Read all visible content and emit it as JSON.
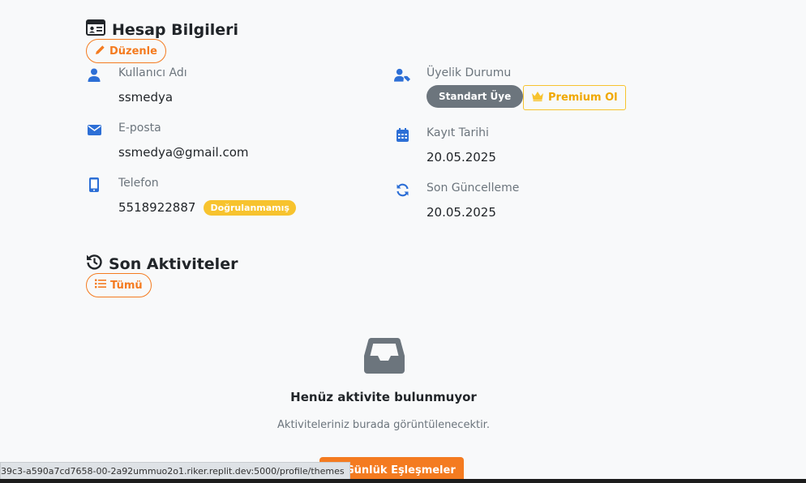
{
  "account": {
    "title": "Hesap Bilgileri",
    "edit_label": "Düzenle",
    "fields": {
      "username": {
        "label": "Kullanıcı Adı",
        "value": "ssmedya"
      },
      "email": {
        "label": "E-posta",
        "value": "ssmedya@gmail.com"
      },
      "phone": {
        "label": "Telefon",
        "value": "5518922887",
        "badge": "Doğrulanmamış"
      },
      "membership": {
        "label": "Üyelik Durumu",
        "badge": "Standart Üye",
        "premium_label": "Premium Ol"
      },
      "registered": {
        "label": "Kayıt Tarihi",
        "value": "20.05.2025"
      },
      "updated": {
        "label": "Son Güncelleme",
        "value": "20.05.2025"
      }
    }
  },
  "activities": {
    "title": "Son Aktiviteler",
    "all_label": "Tümü",
    "empty_title": "Henüz aktivite bulunmuyor",
    "empty_subtitle": "Aktiviteleriniz burada görüntülenecektir.",
    "daily_matches_label": "Günlük Eşleşmeler"
  },
  "status_bar": {
    "url": "39c3-a590a7cd7658-00-2a92ummuo2o1.riker.replit.dev:5000/profile/themes"
  },
  "colors": {
    "accent": "#f47b20",
    "icon_blue": "#2d6fd6",
    "warning": "#f7c32e",
    "secondary": "#6c757d"
  }
}
